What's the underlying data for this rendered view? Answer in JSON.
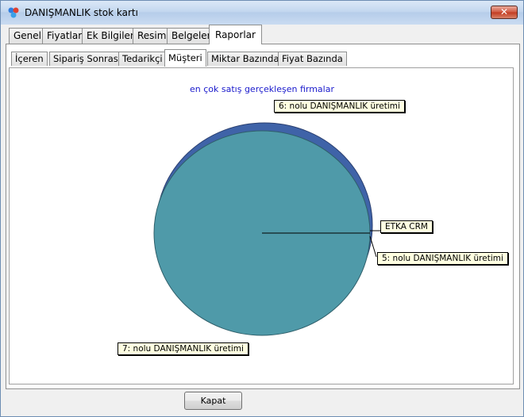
{
  "window": {
    "title": "DANIŞMANLIK stok kartı",
    "close_label": "✕"
  },
  "tabs_main": [
    "Genel",
    "Fiyatlar",
    "Ek Bilgileri",
    "Resim",
    "Belgeler",
    "Raporlar"
  ],
  "tabs_sub": [
    "İçeren",
    "Sipariş Sonrası",
    "Tedarikçi",
    "Müşteri",
    "Miktar Bazında",
    "Fiyat Bazında"
  ],
  "footer": {
    "close_button": "Kapat"
  },
  "colors": {
    "slice_main": "#4f9aa9",
    "slice_second": "#3f63a8",
    "title": "#1a1acc"
  },
  "chart_data": {
    "type": "pie",
    "title": "en çok satış gerçekleşen firmalar",
    "slices": [
      {
        "label": "7: nolu DANIŞMANLIK üretimi",
        "share": 0.965,
        "color": "#4f9aa9"
      },
      {
        "label": "6: nolu DANIŞMANLIK üretimi",
        "share": 0.033,
        "color": "#3f63a8"
      },
      {
        "label": "ETKA CRM",
        "share": 0.001,
        "color": "#4f9aa9"
      },
      {
        "label": "5: nolu DANIŞMANLIK üretimi",
        "share": 0.001,
        "color": "#4f9aa9"
      }
    ]
  }
}
